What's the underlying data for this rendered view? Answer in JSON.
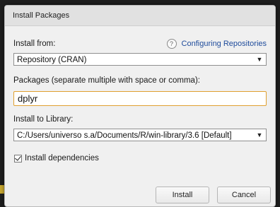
{
  "dialog": {
    "title": "Install Packages"
  },
  "install_from": {
    "label": "Install from:",
    "help_link": "Configuring Repositories",
    "selected": "Repository (CRAN)"
  },
  "packages": {
    "label": "Packages (separate multiple with space or comma):",
    "value": "dplyr"
  },
  "library": {
    "label": "Install to Library:",
    "selected": "C:/Users/universo s.a/Documents/R/win-library/3.6 [Default]"
  },
  "dependencies": {
    "label": "Install dependencies",
    "checked": true
  },
  "buttons": {
    "install": "Install",
    "cancel": "Cancel"
  },
  "icons": {
    "help": "?",
    "dropdown": "▼"
  }
}
